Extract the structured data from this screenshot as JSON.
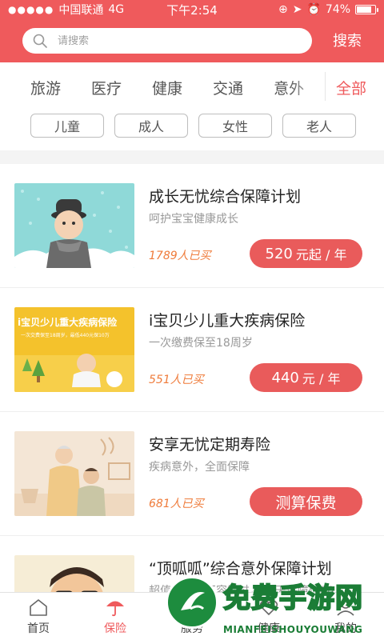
{
  "status": {
    "carrier": "中国联通",
    "network": "4G",
    "time": "下午2:54",
    "battery": "74%",
    "battery_level": 0.74
  },
  "search": {
    "placeholder": "请搜索",
    "button": "搜索"
  },
  "categories": {
    "items": [
      "旅游",
      "医疗",
      "健康",
      "交通",
      "意外"
    ],
    "all": "全部"
  },
  "tags": [
    "儿童",
    "成人",
    "女性",
    "老人"
  ],
  "products": [
    {
      "title": "成长无忧综合保障计划",
      "subtitle": "呵护宝宝健康成长",
      "bought": "1789人已买",
      "price": "520",
      "unit": "元起 / 年"
    },
    {
      "title": "i宝贝少儿重大疾病保险",
      "subtitle": "一次缴费保至18周岁",
      "bought": "551人已买",
      "price": "440",
      "unit": "元 / 年",
      "banner_title": "i宝贝少儿重大疾病保险",
      "banner_sub": "一次交费保至18周岁，最低440元保10万"
    },
    {
      "title": "安享无忧定期寿险",
      "subtitle": "疾病意外，全面保障",
      "bought": "681人已买",
      "button": "测算保费"
    },
    {
      "title": "“顶呱呱”综合意外保障计划",
      "subtitle": "超值实惠，不容错过，30天保障仅88"
    }
  ],
  "tabbar": {
    "items": [
      {
        "label": "首页",
        "icon": "home-icon"
      },
      {
        "label": "保险",
        "icon": "umbrella-icon"
      },
      {
        "label": "服务",
        "icon": "service-icon"
      },
      {
        "label": "健康",
        "icon": "health-icon"
      },
      {
        "label": "我的",
        "icon": "user-icon"
      }
    ]
  },
  "watermark": {
    "text": "免费手游网",
    "url": "MIANFEISHOUYOUWANG"
  },
  "colors": {
    "brand": "#ef5a5c",
    "button": "#e95b5b",
    "bought": "#ef7b3a"
  }
}
